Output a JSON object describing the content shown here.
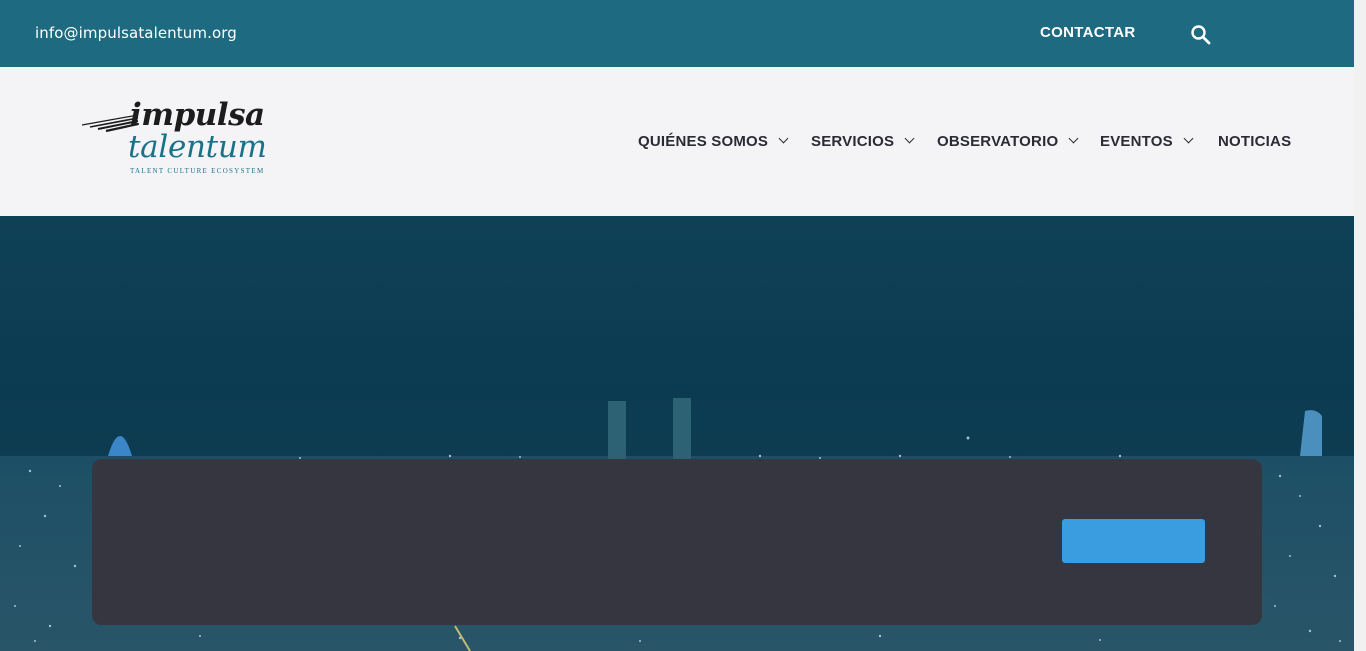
{
  "topbar": {
    "email": "info@impulsatalentum.org",
    "contact_label": "CONTACTAR",
    "search_icon": "search-icon",
    "bg_color": "#1e6a80"
  },
  "logo": {
    "line1": "impulsa",
    "line2": "talentum",
    "tagline": "TALENT CULTURE ECOSYSTEM"
  },
  "nav": {
    "items": [
      {
        "label": "QUIÉNES SOMOS",
        "has_dropdown": true
      },
      {
        "label": "SERVICIOS",
        "has_dropdown": true
      },
      {
        "label": "OBSERVATORIO",
        "has_dropdown": true
      },
      {
        "label": "EVENTOS",
        "has_dropdown": true
      },
      {
        "label": "NOTICIAS",
        "has_dropdown": false
      }
    ]
  },
  "hero": {
    "background": "night-city-skyline-image",
    "overlay_color": "#0b3b51"
  },
  "banner": {
    "bg_color": "#353640",
    "button_label": "",
    "button_color": "#3a9de0"
  }
}
